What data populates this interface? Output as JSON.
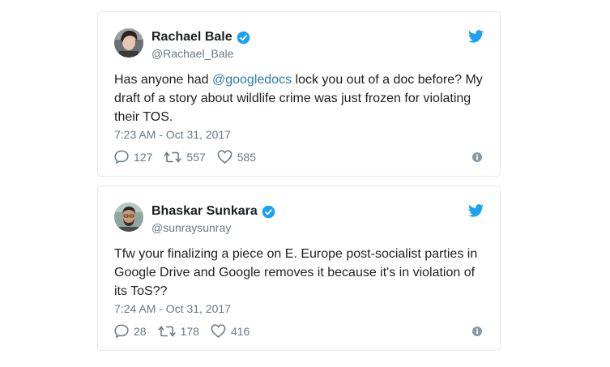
{
  "tweets": [
    {
      "display_name": "Rachael Bale",
      "handle": "@Rachael_Bale",
      "text_before": "Has anyone had ",
      "mention": "@googledocs",
      "text_after": " lock you out of a doc before? My draft of a story about wildlife crime was just frozen for violating their TOS.",
      "timestamp": "7:23 AM - Oct 31, 2017",
      "replies": "127",
      "retweets": "557",
      "likes": "585"
    },
    {
      "display_name": "Bhaskar Sunkara",
      "handle": "@sunraysunray",
      "text_before": "Tfw your finalizing a piece on E. Europe post-socialist parties in Google Drive and Google removes it because it's in violation of its ToS??",
      "mention": "",
      "text_after": "",
      "timestamp": "7:24 AM - Oct 31, 2017",
      "replies": "28",
      "retweets": "178",
      "likes": "416"
    }
  ],
  "colors": {
    "accent": "#1da1f2",
    "link": "#2b7bb9",
    "muted": "#697882",
    "border": "#e1e8ed"
  },
  "icons": [
    "verified-badge-icon",
    "twitter-bird-icon",
    "reply-icon",
    "retweet-icon",
    "like-icon",
    "info-icon"
  ]
}
